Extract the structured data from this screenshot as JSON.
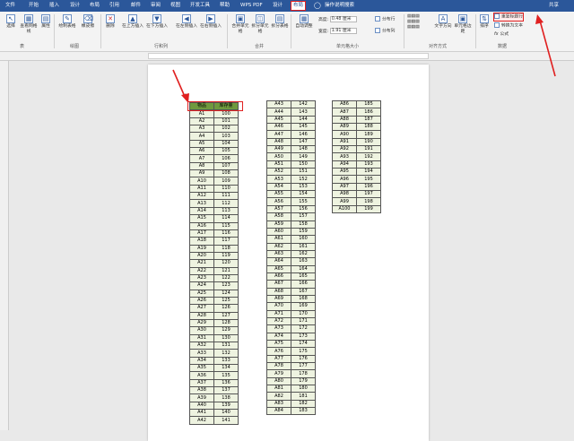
{
  "menubar": {
    "tabs": [
      "文件",
      "开始",
      "插入",
      "设计",
      "布局",
      "引用",
      "邮件",
      "审阅",
      "视图",
      "开发工具",
      "帮助",
      "WPS PDF",
      "设计",
      "布局"
    ],
    "active_tab": "布局",
    "search": "操作说明搜索",
    "share": "共享"
  },
  "ribbon": {
    "table_group": {
      "select": "选择",
      "gridlines": "查看网格线",
      "props": "属性",
      "label": "表"
    },
    "draw_group": {
      "draw": "绘制表格",
      "eraser": "橡皮擦",
      "label": "绘图"
    },
    "rowcol_group": {
      "delete": "删除",
      "insert_above": "在上方插入",
      "insert_below": "在下方插入",
      "insert_left": "在左侧插入",
      "insert_right": "在右侧插入",
      "label": "行和列"
    },
    "merge_group": {
      "merge": "合并单元格",
      "split_cells": "拆分单元格",
      "split_table": "拆分表格",
      "label": "合并"
    },
    "cellsize_group": {
      "autofit": "自动调整",
      "height_label": "高度:",
      "height_value": "0.48 厘米",
      "width_label": "宽度:",
      "width_value": "1.91 厘米",
      "dist_rows": "分布行",
      "dist_cols": "分布列",
      "label": "单元格大小"
    },
    "align_group": {
      "text_dir": "文字方向",
      "margins": "单元格边距",
      "label": "对齐方式"
    },
    "data_group": {
      "sort": "排序",
      "repeat_header": "重复标题行",
      "to_text": "转换为文本",
      "formula": "公式",
      "label": "数据"
    }
  },
  "tables": {
    "header": [
      "物品",
      "库存量"
    ],
    "col1": [
      [
        "A1",
        "100"
      ],
      [
        "A2",
        "101"
      ],
      [
        "A3",
        "102"
      ],
      [
        "A4",
        "103"
      ],
      [
        "A5",
        "104"
      ],
      [
        "A6",
        "105"
      ],
      [
        "A7",
        "106"
      ],
      [
        "A8",
        "107"
      ],
      [
        "A9",
        "108"
      ],
      [
        "A10",
        "109"
      ],
      [
        "A11",
        "110"
      ],
      [
        "A12",
        "111"
      ],
      [
        "A13",
        "112"
      ],
      [
        "A14",
        "113"
      ],
      [
        "A15",
        "114"
      ],
      [
        "A16",
        "115"
      ],
      [
        "A17",
        "116"
      ],
      [
        "A18",
        "117"
      ],
      [
        "A19",
        "118"
      ],
      [
        "A20",
        "119"
      ],
      [
        "A21",
        "120"
      ],
      [
        "A22",
        "121"
      ],
      [
        "A23",
        "122"
      ],
      [
        "A24",
        "123"
      ],
      [
        "A25",
        "124"
      ],
      [
        "A26",
        "125"
      ],
      [
        "A27",
        "126"
      ],
      [
        "A28",
        "127"
      ],
      [
        "A29",
        "128"
      ],
      [
        "A30",
        "129"
      ],
      [
        "A31",
        "130"
      ],
      [
        "A32",
        "131"
      ],
      [
        "A33",
        "132"
      ],
      [
        "A34",
        "133"
      ],
      [
        "A35",
        "134"
      ],
      [
        "A36",
        "135"
      ],
      [
        "A37",
        "136"
      ],
      [
        "A38",
        "137"
      ],
      [
        "A39",
        "138"
      ],
      [
        "A40",
        "139"
      ],
      [
        "A41",
        "140"
      ],
      [
        "A42",
        "141"
      ]
    ],
    "col2": [
      [
        "A43",
        "142"
      ],
      [
        "A44",
        "143"
      ],
      [
        "A45",
        "144"
      ],
      [
        "A46",
        "145"
      ],
      [
        "A47",
        "146"
      ],
      [
        "A48",
        "147"
      ],
      [
        "A49",
        "148"
      ],
      [
        "A50",
        "149"
      ],
      [
        "A51",
        "150"
      ],
      [
        "A52",
        "151"
      ],
      [
        "A53",
        "152"
      ],
      [
        "A54",
        "153"
      ],
      [
        "A55",
        "154"
      ],
      [
        "A56",
        "155"
      ],
      [
        "A57",
        "156"
      ],
      [
        "A58",
        "157"
      ],
      [
        "A59",
        "158"
      ],
      [
        "A60",
        "159"
      ],
      [
        "A61",
        "160"
      ],
      [
        "A62",
        "161"
      ],
      [
        "A63",
        "162"
      ],
      [
        "A64",
        "163"
      ],
      [
        "A65",
        "164"
      ],
      [
        "A66",
        "165"
      ],
      [
        "A67",
        "166"
      ],
      [
        "A68",
        "167"
      ],
      [
        "A69",
        "168"
      ],
      [
        "A70",
        "169"
      ],
      [
        "A71",
        "170"
      ],
      [
        "A72",
        "171"
      ],
      [
        "A73",
        "172"
      ],
      [
        "A74",
        "173"
      ],
      [
        "A75",
        "174"
      ],
      [
        "A76",
        "175"
      ],
      [
        "A77",
        "176"
      ],
      [
        "A78",
        "177"
      ],
      [
        "A79",
        "178"
      ],
      [
        "A80",
        "179"
      ],
      [
        "A81",
        "180"
      ],
      [
        "A82",
        "181"
      ],
      [
        "A83",
        "182"
      ],
      [
        "A84",
        "183"
      ]
    ],
    "col3": [
      [
        "A86",
        "185"
      ],
      [
        "A87",
        "186"
      ],
      [
        "A88",
        "187"
      ],
      [
        "A89",
        "188"
      ],
      [
        "A90",
        "189"
      ],
      [
        "A91",
        "190"
      ],
      [
        "A92",
        "191"
      ],
      [
        "A93",
        "192"
      ],
      [
        "A94",
        "193"
      ],
      [
        "A95",
        "194"
      ],
      [
        "A96",
        "195"
      ],
      [
        "A97",
        "196"
      ],
      [
        "A98",
        "197"
      ],
      [
        "A99",
        "198"
      ],
      [
        "A100",
        "199"
      ]
    ]
  },
  "colors": {
    "accent": "#2b579a",
    "highlight": "#e02020",
    "header_fill": "#6f9a3e",
    "cell_fill": "#eef3e0"
  }
}
